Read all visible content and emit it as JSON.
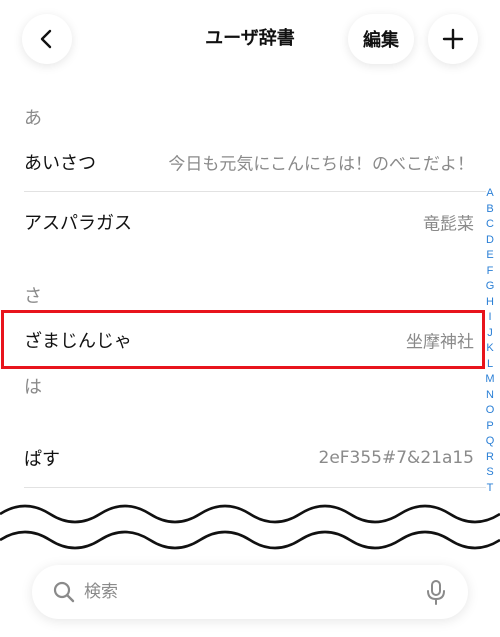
{
  "header": {
    "title": "ユーザ辞書",
    "edit_label": "編集"
  },
  "sections": [
    {
      "header": "あ",
      "entries": [
        {
          "word": "あいさつ",
          "reading": "今日も元気にこんにちは！のべこだよ！"
        },
        {
          "word": "アスパラガス",
          "reading": "竜髭菜"
        }
      ]
    },
    {
      "header": "さ",
      "entries": [
        {
          "word": "ざまじんじゃ",
          "reading": "坐摩神社"
        }
      ]
    },
    {
      "header": "は",
      "entries": [
        {
          "word": "ぱす",
          "reading": "2eF355#7&21a15"
        }
      ]
    }
  ],
  "index_letters": [
    "A",
    "B",
    "C",
    "D",
    "E",
    "F",
    "G",
    "H",
    "I",
    "J",
    "K",
    "L",
    "M",
    "N",
    "O",
    "P",
    "Q",
    "R",
    "S",
    "T"
  ],
  "search": {
    "placeholder": "検索"
  },
  "colors": {
    "accent": "#2a7fd6",
    "highlight": "#e8141c",
    "secondary_text": "#8a8a8a"
  },
  "icons": {
    "back": "chevron-left-icon",
    "add": "plus-icon",
    "search": "search-icon",
    "mic": "microphone-icon"
  }
}
